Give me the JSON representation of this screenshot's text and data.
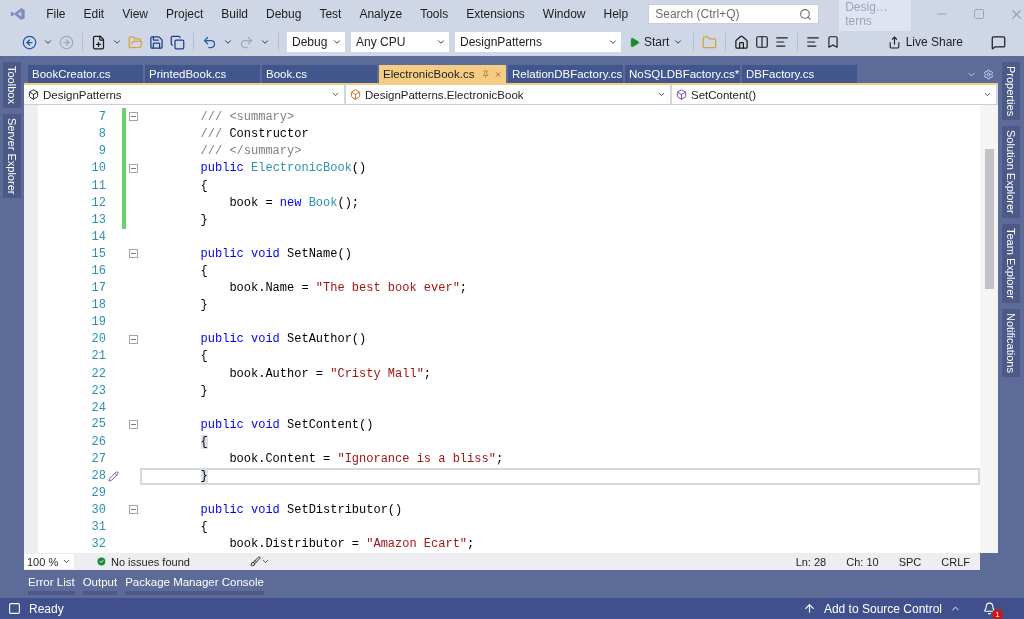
{
  "menu": [
    "File",
    "Edit",
    "View",
    "Project",
    "Build",
    "Debug",
    "Test",
    "Analyze",
    "Tools",
    "Extensions",
    "Window",
    "Help"
  ],
  "search": {
    "placeholder": "Search (Ctrl+Q)"
  },
  "solution_title": "Desig…terns",
  "toolbar": {
    "configuration": "Debug",
    "platform": "Any CPU",
    "startup_project": "DesignPatterns",
    "start": "Start",
    "live_share": "Live Share"
  },
  "left_panels": [
    "Toolbox",
    "Server Explorer"
  ],
  "right_panels": [
    "Properties",
    "Solution Explorer",
    "Team Explorer",
    "Notifications"
  ],
  "tabs": [
    {
      "label": "BookCreator.cs",
      "selected": false
    },
    {
      "label": "PrintedBook.cs",
      "selected": false
    },
    {
      "label": "Book.cs",
      "selected": false
    },
    {
      "label": "ElectronicBook.cs",
      "selected": true
    },
    {
      "label": "RelationDBFactory.cs",
      "selected": false
    },
    {
      "label": "NoSQLDBFactory.cs*",
      "selected": false
    },
    {
      "label": "DBFactory.cs",
      "selected": false
    }
  ],
  "nav_bar": {
    "project": "DesignPatterns",
    "type": "DesignPatterns.ElectronicBook",
    "member": "SetContent()"
  },
  "code_lines": [
    {
      "number": "7",
      "changed": true,
      "fold": true,
      "current": false,
      "tokens": [
        {
          "text": "        /// <summary>",
          "kind": "doc"
        }
      ]
    },
    {
      "number": "8",
      "changed": true,
      "fold": false,
      "current": false,
      "tokens": [
        {
          "text": "        ///",
          "kind": "doc"
        },
        {
          "text": " Constructor",
          "kind": "plain"
        }
      ]
    },
    {
      "number": "9",
      "changed": true,
      "fold": false,
      "current": false,
      "tokens": [
        {
          "text": "        /// </summary>",
          "kind": "doc"
        }
      ]
    },
    {
      "number": "10",
      "changed": true,
      "fold": true,
      "current": false,
      "tokens": [
        {
          "text": "        public",
          "kind": "keyword"
        },
        {
          "text": " ElectronicBook",
          "kind": "type"
        },
        {
          "text": "()",
          "kind": "plain"
        }
      ]
    },
    {
      "number": "11",
      "changed": true,
      "fold": false,
      "current": false,
      "tokens": [
        {
          "text": "        {",
          "kind": "plain"
        }
      ]
    },
    {
      "number": "12",
      "changed": true,
      "fold": false,
      "current": false,
      "tokens": [
        {
          "text": "            book = ",
          "kind": "plain"
        },
        {
          "text": "new",
          "kind": "keyword"
        },
        {
          "text": " Book",
          "kind": "type"
        },
        {
          "text": "();",
          "kind": "plain"
        }
      ]
    },
    {
      "number": "13",
      "changed": true,
      "fold": false,
      "current": false,
      "tokens": [
        {
          "text": "        }",
          "kind": "plain"
        }
      ]
    },
    {
      "number": "14",
      "changed": false,
      "fold": false,
      "current": false
    },
    {
      "number": "15",
      "changed": false,
      "fold": true,
      "current": false,
      "tokens": [
        {
          "text": "        public void",
          "kind": "keyword"
        },
        {
          "text": " SetName()",
          "kind": "plain"
        }
      ]
    },
    {
      "number": "16",
      "changed": false,
      "fold": false,
      "current": false,
      "tokens": [
        {
          "text": "        {",
          "kind": "plain"
        }
      ]
    },
    {
      "number": "17",
      "changed": false,
      "fold": false,
      "current": false,
      "tokens": [
        {
          "text": "            book.Name = ",
          "kind": "plain"
        },
        {
          "text": "\"The best book ever\"",
          "kind": "string"
        },
        {
          "text": ";",
          "kind": "plain"
        }
      ]
    },
    {
      "number": "18",
      "changed": false,
      "fold": false,
      "current": false,
      "tokens": [
        {
          "text": "        }",
          "kind": "plain"
        }
      ]
    },
    {
      "number": "19",
      "changed": false,
      "fold": false,
      "current": false
    },
    {
      "number": "20",
      "changed": false,
      "fold": true,
      "current": false,
      "tokens": [
        {
          "text": "        public void",
          "kind": "keyword"
        },
        {
          "text": " SetAuthor()",
          "kind": "plain"
        }
      ]
    },
    {
      "number": "21",
      "changed": false,
      "fold": false,
      "current": false,
      "tokens": [
        {
          "text": "        {",
          "kind": "plain"
        }
      ]
    },
    {
      "number": "22",
      "changed": false,
      "fold": false,
      "current": false,
      "tokens": [
        {
          "text": "            book.Author = ",
          "kind": "plain"
        },
        {
          "text": "\"Cristy Mall\"",
          "kind": "string"
        },
        {
          "text": ";",
          "kind": "plain"
        }
      ]
    },
    {
      "number": "23",
      "changed": false,
      "fold": false,
      "current": false,
      "tokens": [
        {
          "text": "        }",
          "kind": "plain"
        }
      ]
    },
    {
      "number": "24",
      "changed": false,
      "fold": false,
      "current": false
    },
    {
      "number": "25",
      "changed": false,
      "fold": true,
      "current": false,
      "tokens": [
        {
          "text": "        public void",
          "kind": "keyword"
        },
        {
          "text": " SetContent()",
          "kind": "plain"
        }
      ]
    },
    {
      "number": "26",
      "changed": false,
      "fold": false,
      "current": false,
      "tokens": [
        {
          "text": "        {",
          "kind": "brace_match"
        }
      ]
    },
    {
      "number": "27",
      "changed": false,
      "fold": false,
      "current": false,
      "tokens": [
        {
          "text": "            book.Content = ",
          "kind": "plain"
        },
        {
          "text": "\"Ignorance is a bliss\"",
          "kind": "string"
        },
        {
          "text": ";",
          "kind": "plain"
        }
      ]
    },
    {
      "number": "28",
      "changed": false,
      "fold": false,
      "current": true,
      "tokens": [
        {
          "text": "        }",
          "kind": "brace_match"
        }
      ]
    },
    {
      "number": "29",
      "changed": false,
      "fold": false,
      "current": false
    },
    {
      "number": "30",
      "changed": false,
      "fold": true,
      "current": false,
      "tokens": [
        {
          "text": "        public void",
          "kind": "keyword"
        },
        {
          "text": " SetDistributor()",
          "kind": "plain"
        }
      ]
    },
    {
      "number": "31",
      "changed": false,
      "fold": false,
      "current": false,
      "tokens": [
        {
          "text": "        {",
          "kind": "plain"
        }
      ]
    },
    {
      "number": "32",
      "changed": false,
      "fold": false,
      "current": false,
      "tokens": [
        {
          "text": "            book.Distributor = ",
          "kind": "plain"
        },
        {
          "text": "\"Amazon Ecart\"",
          "kind": "string"
        },
        {
          "text": ";",
          "kind": "plain"
        }
      ]
    }
  ],
  "editor_status": {
    "zoom": "100 %",
    "issues": "No issues found",
    "line": "Ln: 28",
    "column": "Ch: 10",
    "whitespace": "SPC",
    "line_endings": "CRLF"
  },
  "tool_tabs": [
    "Error List",
    "Output",
    "Package Manager Console"
  ],
  "status_bar": {
    "state": "Ready",
    "source_control": "Add to Source Control",
    "notification_count": "1"
  }
}
